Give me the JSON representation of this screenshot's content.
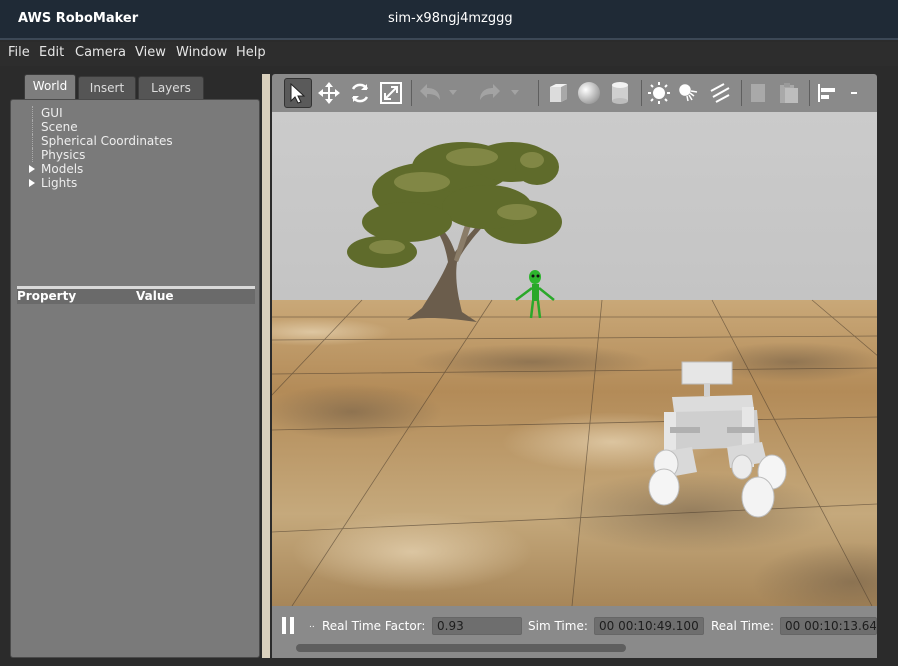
{
  "titlebar": {
    "app_name": "AWS RoboMaker",
    "sim_name": "sim-x98ngj4mzggg"
  },
  "menu": {
    "file": "File",
    "edit": "Edit",
    "camera": "Camera",
    "view": "View",
    "window": "Window",
    "help": "Help"
  },
  "left_panel": {
    "tabs": [
      "World",
      "Insert",
      "Layers"
    ],
    "active_tab": "World",
    "tree": [
      "GUI",
      "Scene",
      "Spherical Coordinates",
      "Physics",
      "Models",
      "Lights"
    ],
    "property_header": {
      "property": "Property",
      "value": "Value"
    }
  },
  "toolbar": {
    "icons": [
      "select-arrow-icon",
      "translate-icon",
      "rotate-icon",
      "scale-icon",
      "undo-icon",
      "undo-dropdown-icon",
      "redo-icon",
      "redo-dropdown-icon",
      "box-shape-icon",
      "sphere-shape-icon",
      "cylinder-shape-icon",
      "point-light-icon",
      "spot-light-icon",
      "directional-light-icon",
      "copy-icon",
      "paste-icon",
      "align-icon"
    ],
    "active_tool": "select-arrow-icon"
  },
  "status": {
    "rtf_label": "Real Time Factor:",
    "rtf_value": "0.93",
    "sim_time_label": "Sim Time:",
    "sim_time_value": "00 00:10:49.100",
    "real_time_label": "Real Time:",
    "real_time_value": "00 00:10:13.64",
    "step_label": ".."
  },
  "colors": {
    "titlebar": "#1f2a36",
    "panel": "#7a7a7a",
    "toolbar": "#8a8a8a",
    "sky": "#c9c9c9",
    "ground": "#b89262"
  }
}
